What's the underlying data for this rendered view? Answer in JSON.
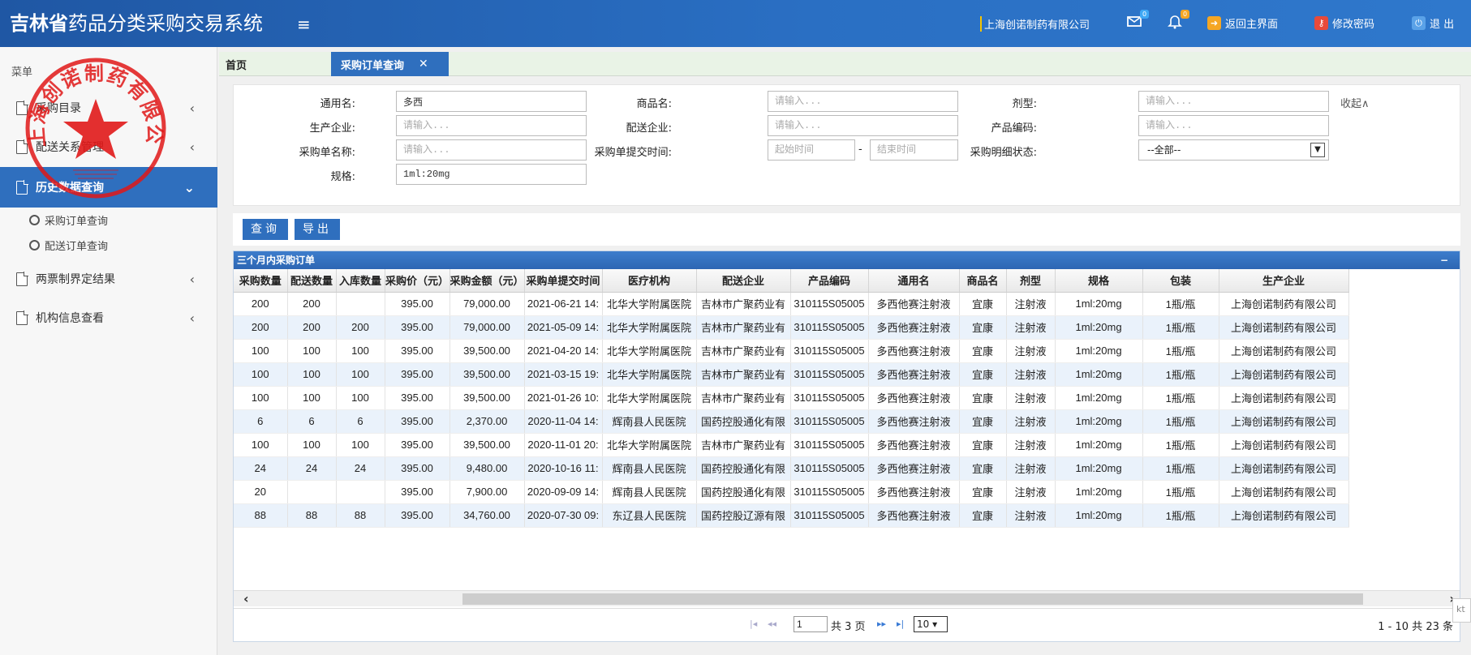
{
  "header": {
    "brand_bold": "吉林省",
    "brand_rest": "药品分类采购交易系统",
    "menu_icon": "≡",
    "company": "上海创诺制药有限公司",
    "mail_badge": "0",
    "bell_badge": "0",
    "back_label": "返回主界面",
    "password_label": "修改密码",
    "logout_label": "退 出"
  },
  "sidebar": {
    "title": "菜单",
    "items": [
      {
        "label": "采购目录"
      },
      {
        "label": "配送关系管理"
      },
      {
        "label": "历史数据查询"
      },
      {
        "label": "两票制界定结果"
      },
      {
        "label": "机构信息查看"
      }
    ],
    "sub_items": [
      {
        "label": "采购订单查询"
      },
      {
        "label": "配送订单查询"
      }
    ],
    "seal_text": "上海创诺制药有限公司"
  },
  "tabs": {
    "home": "首页",
    "active": "采购订单查询",
    "close": "✕"
  },
  "filter": {
    "generic_name_label": "通用名:",
    "generic_name_value": "多西",
    "product_name_label": "商品名:",
    "product_name_placeholder": "请输入...",
    "dosage_label": "剂型:",
    "dosage_placeholder": "请输入...",
    "collapse": "收起∧",
    "manufacturer_label": "生产企业:",
    "manufacturer_placeholder": "请输入...",
    "distributor_label": "配送企业:",
    "distributor_placeholder": "请输入...",
    "product_code_label": "产品编码:",
    "product_code_placeholder": "请输入...",
    "order_name_label": "采购单名称:",
    "order_name_placeholder": "请输入...",
    "submit_time_label": "采购单提交时间:",
    "start_placeholder": "起始时间",
    "time_sep": "-",
    "end_placeholder": "结束时间",
    "status_label": "采购明细状态:",
    "status_value": "--全部--",
    "spec_label": "规格:",
    "spec_value": "1ml:20mg"
  },
  "actions": {
    "query": "查询",
    "export": "导出"
  },
  "grid": {
    "title": "三个月内采购订单",
    "minimize": "−",
    "columns": [
      "采购数量",
      "配送数量",
      "入库数量",
      "采购价（元）",
      "采购金额（元）",
      "采购单提交时间",
      "医疗机构",
      "配送企业",
      "产品编码",
      "通用名",
      "商品名",
      "剂型",
      "规格",
      "包装",
      "生产企业"
    ],
    "rows": [
      [
        "200",
        "200",
        "",
        "395.00",
        "79,000.00",
        "2021-06-21 14:",
        "北华大学附属医院",
        "吉林市广聚药业有",
        "310115S05005",
        "多西他赛注射液",
        "宜康",
        "注射液",
        "1ml:20mg",
        "1瓶/瓶",
        "上海创诺制药有限公司"
      ],
      [
        "200",
        "200",
        "200",
        "395.00",
        "79,000.00",
        "2021-05-09 14:",
        "北华大学附属医院",
        "吉林市广聚药业有",
        "310115S05005",
        "多西他赛注射液",
        "宜康",
        "注射液",
        "1ml:20mg",
        "1瓶/瓶",
        "上海创诺制药有限公司"
      ],
      [
        "100",
        "100",
        "100",
        "395.00",
        "39,500.00",
        "2021-04-20 14:",
        "北华大学附属医院",
        "吉林市广聚药业有",
        "310115S05005",
        "多西他赛注射液",
        "宜康",
        "注射液",
        "1ml:20mg",
        "1瓶/瓶",
        "上海创诺制药有限公司"
      ],
      [
        "100",
        "100",
        "100",
        "395.00",
        "39,500.00",
        "2021-03-15 19:",
        "北华大学附属医院",
        "吉林市广聚药业有",
        "310115S05005",
        "多西他赛注射液",
        "宜康",
        "注射液",
        "1ml:20mg",
        "1瓶/瓶",
        "上海创诺制药有限公司"
      ],
      [
        "100",
        "100",
        "100",
        "395.00",
        "39,500.00",
        "2021-01-26 10:",
        "北华大学附属医院",
        "吉林市广聚药业有",
        "310115S05005",
        "多西他赛注射液",
        "宜康",
        "注射液",
        "1ml:20mg",
        "1瓶/瓶",
        "上海创诺制药有限公司"
      ],
      [
        "6",
        "6",
        "6",
        "395.00",
        "2,370.00",
        "2020-11-04 14:",
        "辉南县人民医院",
        "国药控股通化有限",
        "310115S05005",
        "多西他赛注射液",
        "宜康",
        "注射液",
        "1ml:20mg",
        "1瓶/瓶",
        "上海创诺制药有限公司"
      ],
      [
        "100",
        "100",
        "100",
        "395.00",
        "39,500.00",
        "2020-11-01 20:",
        "北华大学附属医院",
        "吉林市广聚药业有",
        "310115S05005",
        "多西他赛注射液",
        "宜康",
        "注射液",
        "1ml:20mg",
        "1瓶/瓶",
        "上海创诺制药有限公司"
      ],
      [
        "24",
        "24",
        "24",
        "395.00",
        "9,480.00",
        "2020-10-16 11:",
        "辉南县人民医院",
        "国药控股通化有限",
        "310115S05005",
        "多西他赛注射液",
        "宜康",
        "注射液",
        "1ml:20mg",
        "1瓶/瓶",
        "上海创诺制药有限公司"
      ],
      [
        "20",
        "",
        "",
        "395.00",
        "7,900.00",
        "2020-09-09 14:",
        "辉南县人民医院",
        "国药控股通化有限",
        "310115S05005",
        "多西他赛注射液",
        "宜康",
        "注射液",
        "1ml:20mg",
        "1瓶/瓶",
        "上海创诺制药有限公司"
      ],
      [
        "88",
        "88",
        "88",
        "395.00",
        "34,760.00",
        "2020-07-30 09:",
        "东辽县人民医院",
        "国药控股辽源有限",
        "310115S05005",
        "多西他赛注射液",
        "宜康",
        "注射液",
        "1ml:20mg",
        "1瓶/瓶",
        "上海创诺制药有限公司"
      ]
    ]
  },
  "pager": {
    "first": "|◂",
    "prev": "◂◂",
    "page": "1",
    "total_pages": "共 3 页",
    "next": "▸▸",
    "last": "▸|",
    "page_size": "10",
    "range": "1 - 10   共 23 条"
  },
  "edge_tip": "kt"
}
